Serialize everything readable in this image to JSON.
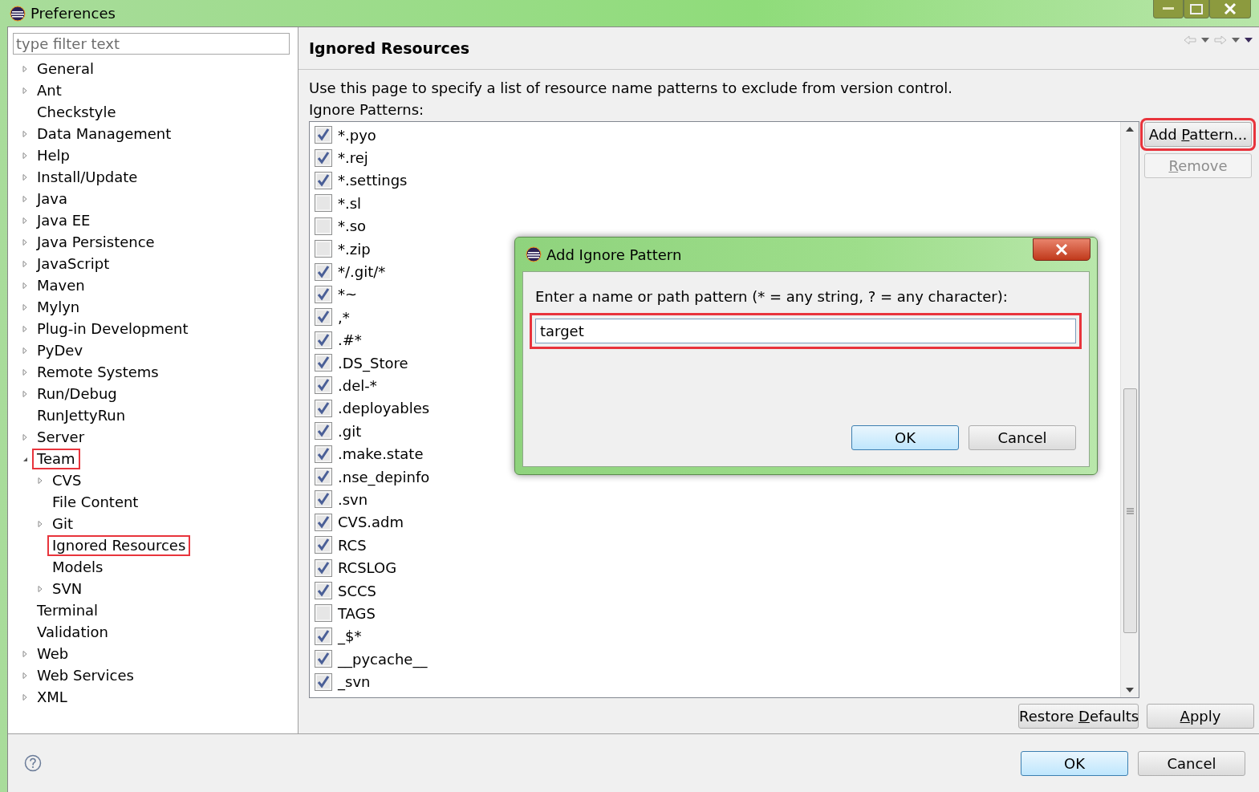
{
  "window": {
    "title": "Preferences"
  },
  "sidebar": {
    "filter": {
      "placeholder": "type filter text"
    },
    "items": [
      {
        "label": "General",
        "kind": "folder",
        "expanded": false,
        "annotated": false
      },
      {
        "label": "Ant",
        "kind": "folder",
        "expanded": false,
        "annotated": false
      },
      {
        "label": "Checkstyle",
        "kind": "leaf",
        "annotated": false
      },
      {
        "label": "Data Management",
        "kind": "folder",
        "expanded": false,
        "annotated": false
      },
      {
        "label": "Help",
        "kind": "folder",
        "expanded": false,
        "annotated": false
      },
      {
        "label": "Install/Update",
        "kind": "folder",
        "expanded": false,
        "annotated": false
      },
      {
        "label": "Java",
        "kind": "folder",
        "expanded": false,
        "annotated": false
      },
      {
        "label": "Java EE",
        "kind": "folder",
        "expanded": false,
        "annotated": false
      },
      {
        "label": "Java Persistence",
        "kind": "folder",
        "expanded": false,
        "annotated": false
      },
      {
        "label": "JavaScript",
        "kind": "folder",
        "expanded": false,
        "annotated": false
      },
      {
        "label": "Maven",
        "kind": "folder",
        "expanded": false,
        "annotated": false
      },
      {
        "label": "Mylyn",
        "kind": "folder",
        "expanded": false,
        "annotated": false
      },
      {
        "label": "Plug-in Development",
        "kind": "folder",
        "expanded": false,
        "annotated": false
      },
      {
        "label": "PyDev",
        "kind": "folder",
        "expanded": false,
        "annotated": false
      },
      {
        "label": "Remote Systems",
        "kind": "folder",
        "expanded": false,
        "annotated": false
      },
      {
        "label": "Run/Debug",
        "kind": "folder",
        "expanded": false,
        "annotated": false
      },
      {
        "label": "RunJettyRun",
        "kind": "leaf",
        "annotated": false
      },
      {
        "label": "Server",
        "kind": "folder",
        "expanded": false,
        "annotated": false
      },
      {
        "label": "Team",
        "kind": "folder",
        "expanded": true,
        "annotated": true,
        "children": [
          {
            "label": "CVS",
            "kind": "folder",
            "expanded": false,
            "annotated": false
          },
          {
            "label": "File Content",
            "kind": "leaf",
            "annotated": false
          },
          {
            "label": "Git",
            "kind": "folder",
            "expanded": false,
            "annotated": false
          },
          {
            "label": "Ignored Resources",
            "kind": "leaf",
            "annotated": true
          },
          {
            "label": "Models",
            "kind": "leaf",
            "annotated": false
          },
          {
            "label": "SVN",
            "kind": "folder",
            "expanded": false,
            "annotated": false
          }
        ]
      },
      {
        "label": "Terminal",
        "kind": "leaf",
        "annotated": false
      },
      {
        "label": "Validation",
        "kind": "leaf",
        "annotated": false
      },
      {
        "label": "Web",
        "kind": "folder",
        "expanded": false,
        "annotated": false
      },
      {
        "label": "Web Services",
        "kind": "folder",
        "expanded": false,
        "annotated": false
      },
      {
        "label": "XML",
        "kind": "folder",
        "expanded": false,
        "annotated": false
      }
    ]
  },
  "page": {
    "title": "Ignored Resources",
    "description": "Use this page to specify a list of resource name patterns to exclude from version control.",
    "list_label": "Ignore Patterns:",
    "patterns": [
      {
        "label": "*.pyo",
        "checked": true
      },
      {
        "label": "*.rej",
        "checked": true
      },
      {
        "label": "*.settings",
        "checked": true
      },
      {
        "label": "*.sl",
        "checked": false
      },
      {
        "label": "*.so",
        "checked": false
      },
      {
        "label": "*.zip",
        "checked": false
      },
      {
        "label": "*/.git/*",
        "checked": true
      },
      {
        "label": "*~",
        "checked": true
      },
      {
        "label": ",*",
        "checked": true
      },
      {
        "label": ".#*",
        "checked": true
      },
      {
        "label": ".DS_Store",
        "checked": true
      },
      {
        "label": ".del-*",
        "checked": true
      },
      {
        "label": ".deployables",
        "checked": true
      },
      {
        "label": ".git",
        "checked": true
      },
      {
        "label": ".make.state",
        "checked": true
      },
      {
        "label": ".nse_depinfo",
        "checked": true
      },
      {
        "label": ".svn",
        "checked": true
      },
      {
        "label": "CVS.adm",
        "checked": true
      },
      {
        "label": "RCS",
        "checked": true
      },
      {
        "label": "RCSLOG",
        "checked": true
      },
      {
        "label": "SCCS",
        "checked": true
      },
      {
        "label": "TAGS",
        "checked": false
      },
      {
        "label": "_$*",
        "checked": true
      },
      {
        "label": "__pycache__",
        "checked": true
      },
      {
        "label": "_svn",
        "checked": true
      }
    ],
    "side_buttons": [
      {
        "before": "Add ",
        "key": "P",
        "after": "attern...",
        "disabled": false,
        "annotated": true
      },
      {
        "key": "R",
        "after": "emove",
        "disabled": true,
        "annotated": false
      }
    ],
    "buttons": [
      {
        "before": "Restore ",
        "key": "D",
        "after": "efaults"
      },
      {
        "key": "A",
        "after": "pply"
      }
    ]
  },
  "footer": {
    "buttons": [
      {
        "label": "OK",
        "default": true
      },
      {
        "label": "Cancel",
        "default": false
      }
    ]
  },
  "dialog": {
    "title": "Add Ignore Pattern",
    "prompt": "Enter a name or path pattern (* = any string, ? = any character):",
    "value": "target",
    "annotated": true,
    "buttons": [
      {
        "label": "OK",
        "default": true
      },
      {
        "label": "Cancel",
        "default": false
      }
    ]
  }
}
